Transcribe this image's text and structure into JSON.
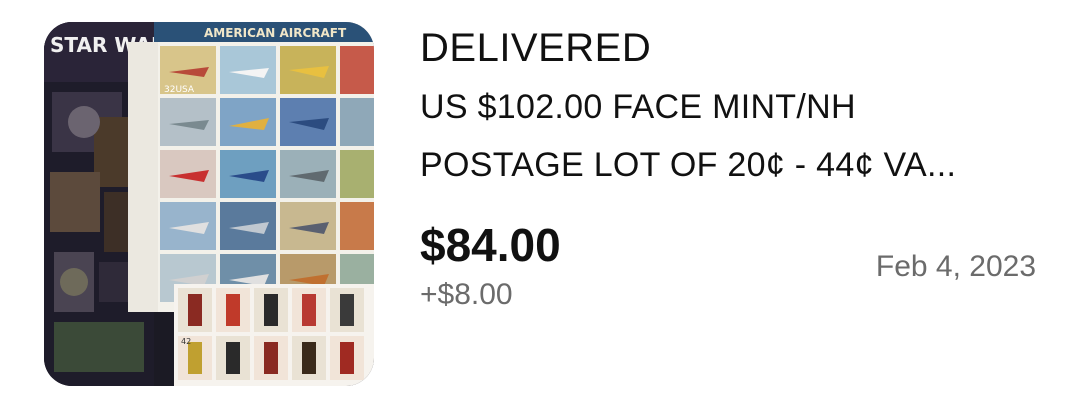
{
  "order": {
    "status": "DELIVERED",
    "title_line1": "US $102.00 FACE MINT/NH",
    "title_line2": "POSTAGE LOT OF 20¢ - 44¢ VA...",
    "price": "$84.00",
    "shipping": "+$8.00",
    "date": "Feb 4, 2023"
  },
  "thumbnail": {
    "sheet_header": "AMERICAN AIRCRAFT",
    "brand_text": "STAR WARS",
    "stamp_denomination": "32USA",
    "stamp_denomination_small": "42"
  },
  "colors": {
    "text_primary": "#111111",
    "text_secondary": "#6b6b6b",
    "background": "#ffffff"
  }
}
